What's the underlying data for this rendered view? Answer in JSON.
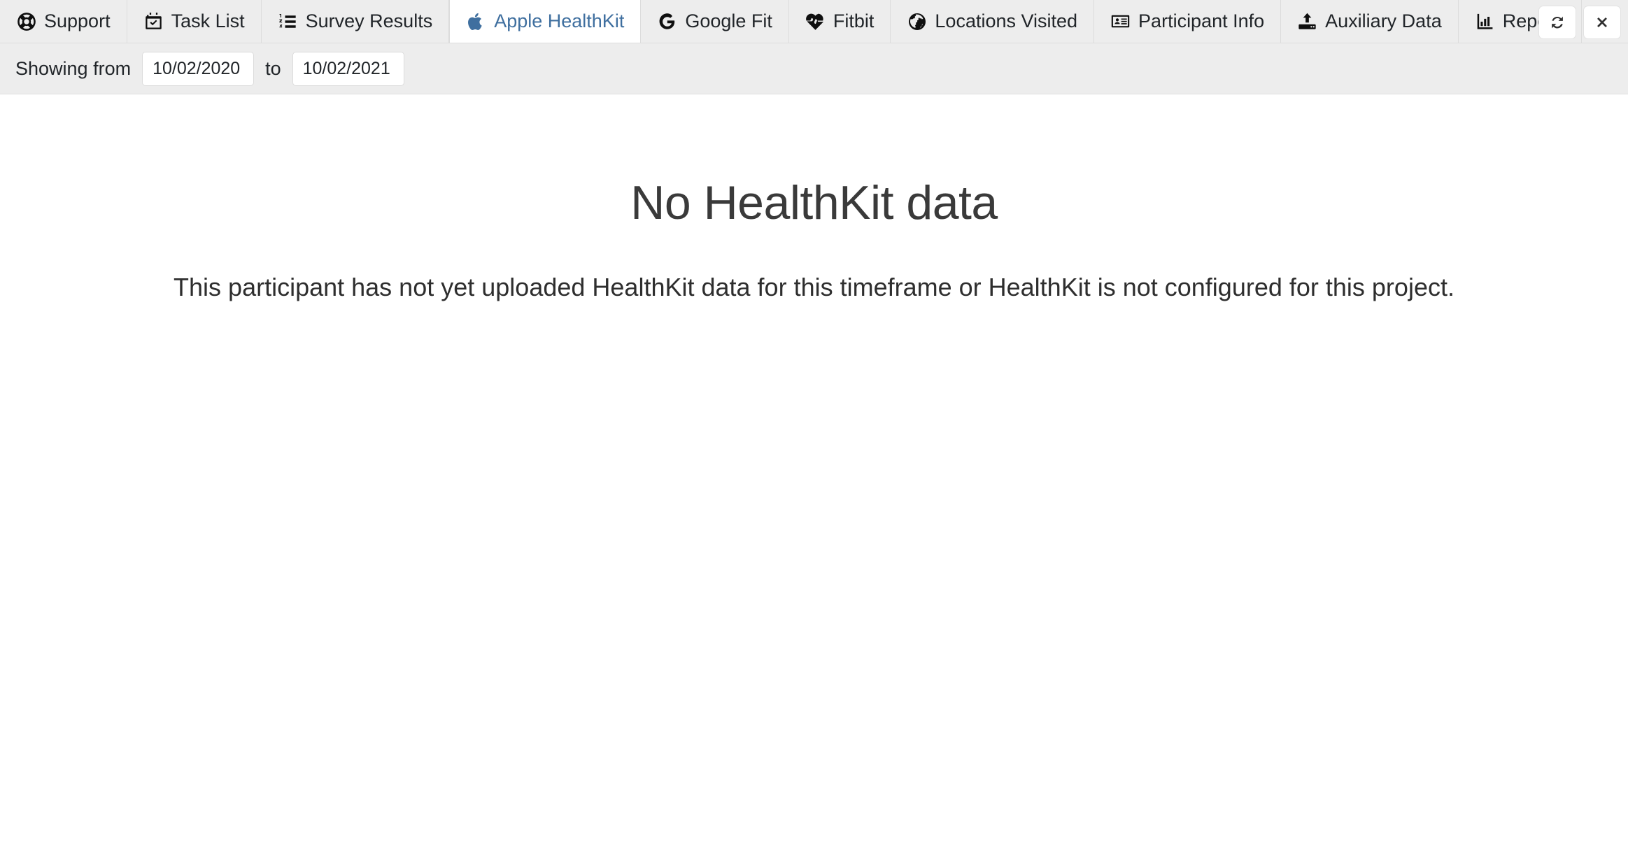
{
  "tabs": [
    {
      "id": "support",
      "label": "Support",
      "icon": "life-ring-icon",
      "active": false
    },
    {
      "id": "task-list",
      "label": "Task List",
      "icon": "calendar-check-icon",
      "active": false
    },
    {
      "id": "survey-results",
      "label": "Survey Results",
      "icon": "numbered-list-icon",
      "active": false
    },
    {
      "id": "apple-healthkit",
      "label": "Apple HealthKit",
      "icon": "apple-icon",
      "active": true
    },
    {
      "id": "google-fit",
      "label": "Google Fit",
      "icon": "google-icon",
      "active": false
    },
    {
      "id": "fitbit",
      "label": "Fitbit",
      "icon": "heartbeat-icon",
      "active": false
    },
    {
      "id": "locations-visited",
      "label": "Locations Visited",
      "icon": "globe-icon",
      "active": false
    },
    {
      "id": "participant-info",
      "label": "Participant Info",
      "icon": "id-card-icon",
      "active": false
    },
    {
      "id": "auxiliary-data",
      "label": "Auxiliary Data",
      "icon": "upload-icon",
      "active": false
    },
    {
      "id": "reports",
      "label": "Reports",
      "icon": "bar-chart-icon",
      "active": false
    }
  ],
  "actions": {
    "refresh_icon": "refresh-icon",
    "close_icon": "close-icon"
  },
  "filter": {
    "prefix_label": "Showing from",
    "separator_label": "to",
    "from_value": "10/02/2020",
    "to_value": "10/02/2021",
    "from_placeholder": "mm/dd/yyyy",
    "to_placeholder": "mm/dd/yyyy"
  },
  "main": {
    "title": "No HealthKit data",
    "description": "This participant has not yet uploaded HealthKit data for this timeframe or HealthKit is not configured for this project."
  },
  "colors": {
    "active_tab_text": "#3f6f9f",
    "bar_background": "#ededed",
    "page_background": "#ffffff",
    "body_text": "#212529"
  }
}
